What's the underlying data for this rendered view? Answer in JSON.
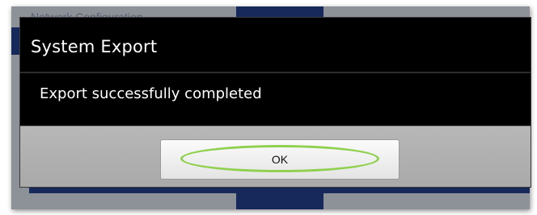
{
  "background": {
    "title": "Network Configuration",
    "title_right": ""
  },
  "dialog": {
    "title": "System Export",
    "message": "Export successfully completed",
    "ok_label": "OK"
  },
  "colors": {
    "dialog_background": "#000000",
    "button_bar": "#b0b0b0",
    "highlight": "#8fd14f",
    "app_background": "#17295a"
  }
}
